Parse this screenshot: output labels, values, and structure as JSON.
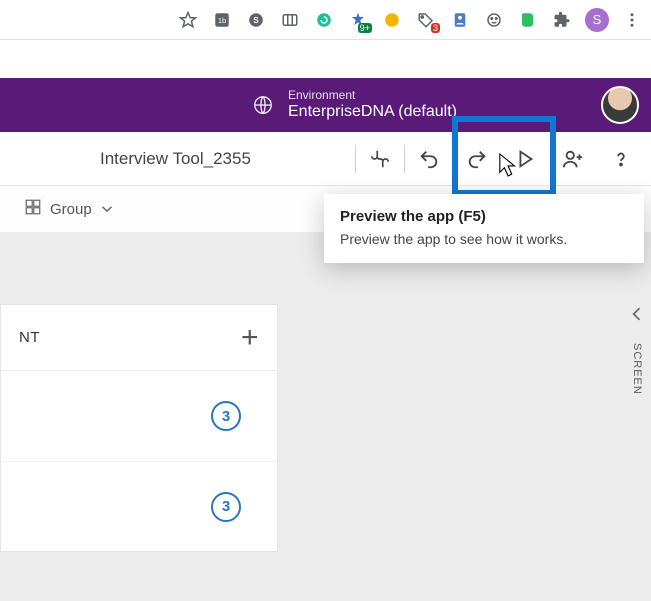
{
  "browser": {
    "avatar_initial": "S",
    "notif_badge": "3",
    "plus_badge": "9+"
  },
  "environment": {
    "label": "Environment",
    "name": "EnterpriseDNA (default)"
  },
  "toolbar": {
    "app_title": "Interview Tool_2355"
  },
  "secondary": {
    "group_label": "Group"
  },
  "left_panel": {
    "heading_suffix": "NT",
    "counts": [
      "3",
      "3"
    ]
  },
  "right_rail": {
    "label": "SCREEN"
  },
  "tooltip": {
    "title": "Preview the app (F5)",
    "body": "Preview the app to see how it works."
  }
}
